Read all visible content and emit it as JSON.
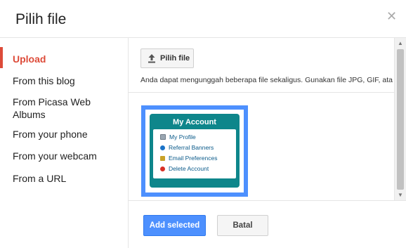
{
  "dialog": {
    "title": "Pilih file",
    "close_icon": "close-icon"
  },
  "sidebar": {
    "items": [
      {
        "label": "Upload",
        "active": true
      },
      {
        "label": "From this blog"
      },
      {
        "label": "From Picasa Web Albums"
      },
      {
        "label": "From your phone"
      },
      {
        "label": "From your webcam"
      },
      {
        "label": "From a URL"
      }
    ]
  },
  "upload": {
    "button_label": "Pilih file",
    "button_icon": "upload-arrow-icon",
    "hint": "Anda dapat mengunggah beberapa file sekaligus. Gunakan file JPG, GIF, ata"
  },
  "thumbnail": {
    "selected": true,
    "widget_title": "My Account",
    "items": [
      {
        "label": "My Profile",
        "icon": "profile-icon",
        "color": "#9aa6b2"
      },
      {
        "label": "Referral Banners",
        "icon": "info-icon",
        "color": "#1a73c8"
      },
      {
        "label": "Email Preferences",
        "icon": "email-icon",
        "color": "#c9a227"
      },
      {
        "label": "Delete Account",
        "icon": "delete-icon",
        "color": "#d93025"
      }
    ]
  },
  "footer": {
    "add_label": "Add selected",
    "cancel_label": "Batal"
  },
  "colors": {
    "accent_red": "#dd4b39",
    "primary_blue": "#4d90fe",
    "widget_teal": "#0e868b"
  }
}
